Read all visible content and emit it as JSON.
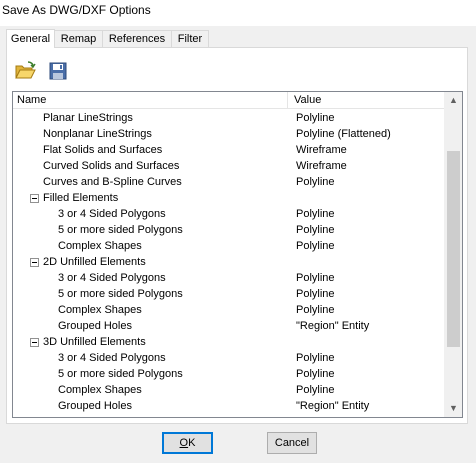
{
  "window": {
    "title": "Save As DWG/DXF Options"
  },
  "tabs": [
    {
      "label": "General",
      "active": true
    },
    {
      "label": "Remap",
      "active": false
    },
    {
      "label": "References",
      "active": false
    },
    {
      "label": "Filter",
      "active": false
    }
  ],
  "toolbar": {
    "icons": [
      "open-folder-icon",
      "save-icon"
    ]
  },
  "grid": {
    "columns": {
      "name": "Name",
      "value": "Value"
    },
    "rows": [
      {
        "name": "Planar LineStrings",
        "value": "Polyline",
        "level": 2
      },
      {
        "name": "Nonplanar LineStrings",
        "value": "Polyline (Flattened)",
        "level": 2
      },
      {
        "name": "Flat Solids and Surfaces",
        "value": "Wireframe",
        "level": 2
      },
      {
        "name": "Curved Solids and Surfaces",
        "value": "Wireframe",
        "level": 2
      },
      {
        "name": "Curves and B-Spline Curves",
        "value": "Polyline",
        "level": 2
      },
      {
        "name": "Filled Elements",
        "value": "",
        "level": 1,
        "group": true
      },
      {
        "name": "3 or 4 Sided Polygons",
        "value": "Polyline",
        "level": 3
      },
      {
        "name": "5 or more sided Polygons",
        "value": "Polyline",
        "level": 3
      },
      {
        "name": "Complex Shapes",
        "value": "Polyline",
        "level": 3
      },
      {
        "name": "2D Unfilled Elements",
        "value": "",
        "level": 1,
        "group": true
      },
      {
        "name": "3 or 4 Sided Polygons",
        "value": "Polyline",
        "level": 3
      },
      {
        "name": "5 or more sided Polygons",
        "value": "Polyline",
        "level": 3
      },
      {
        "name": "Complex Shapes",
        "value": "Polyline",
        "level": 3
      },
      {
        "name": "Grouped Holes",
        "value": "\"Region\" Entity",
        "level": 3
      },
      {
        "name": "3D Unfilled Elements",
        "value": "",
        "level": 1,
        "group": true
      },
      {
        "name": "3 or 4 Sided Polygons",
        "value": "Polyline",
        "level": 3
      },
      {
        "name": "5 or more sided Polygons",
        "value": "Polyline",
        "level": 3
      },
      {
        "name": "Complex Shapes",
        "value": "Polyline",
        "level": 3
      },
      {
        "name": "Grouped Holes",
        "value": "\"Region\" Entity",
        "level": 3
      },
      {
        "name": "",
        "value": "",
        "level": 0,
        "group": true
      }
    ]
  },
  "buttons": {
    "ok": {
      "accesskey": "O",
      "rest": "K"
    },
    "cancel": "Cancel"
  },
  "colors": {
    "focus": "#0078d7",
    "button_face": "#e1e1e1",
    "scroll_thumb": "#cdcdcd"
  }
}
